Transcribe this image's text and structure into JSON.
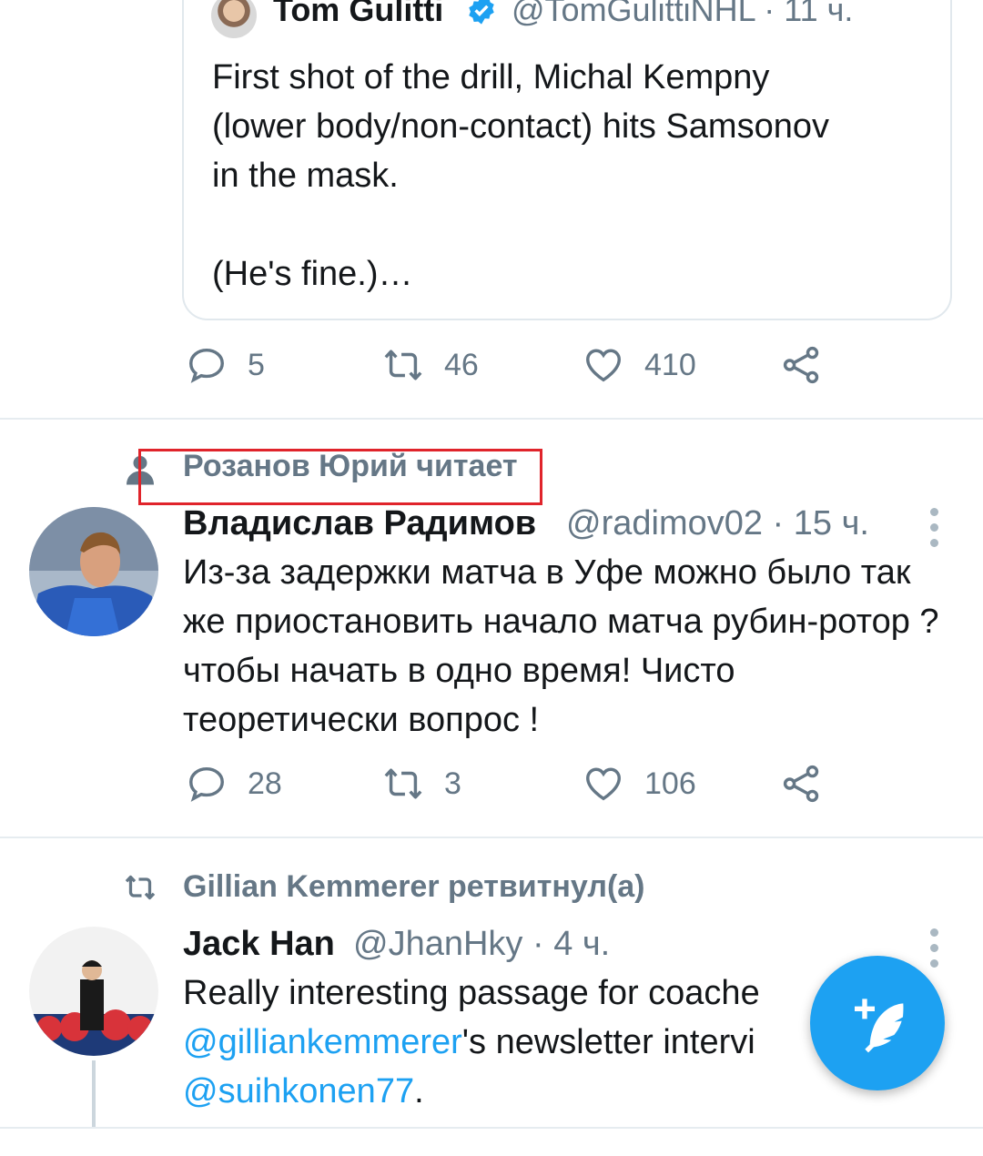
{
  "quoted_tweet": {
    "author": "Tom Gulitti",
    "handle_time": "@TomGulittiNHL · 11 ч.",
    "text": "First shot of the drill, Michal Kempny\n(lower body/non-contact) hits Samsonov\nin the mask.\n\n(He's fine.)…"
  },
  "tweet1_actions": {
    "replies": "5",
    "retweets": "46",
    "likes": "410"
  },
  "tweet2": {
    "context": "Розанов Юрий читает",
    "author": "Владислав Радимов",
    "handle_time": "@radimov02 · 15 ч.",
    "text": "Из-за задержки матча в Уфе можно было так же приостановить начало матча рубин-ротор ?чтобы начать в одно время! Чисто теоретически вопрос !",
    "replies": "28",
    "retweets": "3",
    "likes": "106"
  },
  "tweet3": {
    "context": "Gillian Kemmerer ретвитнул(а)",
    "author": "Jack Han",
    "handle_time": "@JhanHky · 4 ч.",
    "text_part1": "Really interesting passage for coache",
    "mention1": "@gilliankemmerer",
    "text_part2": "'s newsletter intervi",
    "mention2": "@suihkonen77",
    "text_part3": "."
  },
  "colors": {
    "accent": "#1da1f2",
    "secondary_text": "#657786",
    "highlight_box": "#e0242b"
  },
  "icons": [
    "verified-badge-icon",
    "reply-icon",
    "retweet-icon",
    "like-icon",
    "share-icon",
    "person-icon",
    "more-vertical-icon",
    "compose-tweet-icon"
  ]
}
